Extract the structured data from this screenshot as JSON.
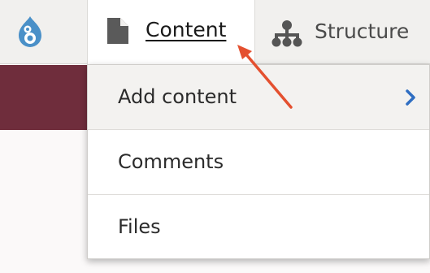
{
  "toolbar": {
    "logo_icon": "drupal-logo-icon",
    "tabs": [
      {
        "label": "Content",
        "icon": "document-icon",
        "active": true
      },
      {
        "label": "Structure",
        "icon": "sitemap-icon",
        "active": false
      }
    ]
  },
  "dropdown": {
    "items": [
      {
        "label": "Add content",
        "has_submenu": true,
        "submenu_icon": "chevron-right-icon",
        "hovered": true
      },
      {
        "label": "Comments",
        "has_submenu": false
      },
      {
        "label": "Files",
        "has_submenu": false
      }
    ]
  },
  "annotation": {
    "type": "arrow",
    "points_to": "Content"
  },
  "colors": {
    "toolbar_bg": "#f1f0ee",
    "header_band": "#6f2d3c",
    "logo_blue": "#4a90c8",
    "chevron_blue": "#2f6ec2",
    "arrow_red": "#e4502f"
  }
}
